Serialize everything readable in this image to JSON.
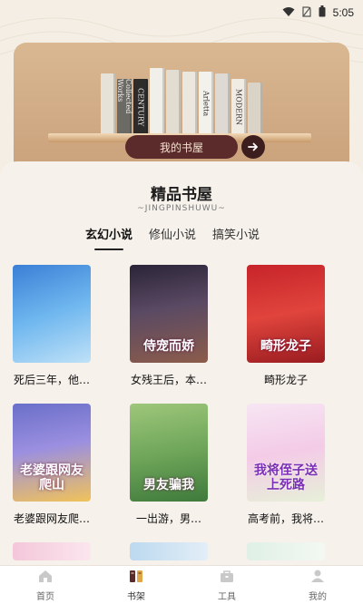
{
  "status": {
    "time": "5:05"
  },
  "hero": {
    "books": [
      {
        "spine": "",
        "color": "#e7e2d8",
        "h": 68
      },
      {
        "spine": "Collected Works",
        "color": "#6c6a64",
        "h": 62
      },
      {
        "spine": "CENTURY",
        "color": "#2e2c2a",
        "h": 62
      },
      {
        "spine": "",
        "color": "#f1efe9",
        "h": 74
      },
      {
        "spine": "",
        "color": "#e3ddd1",
        "h": 72
      },
      {
        "spine": "",
        "color": "#ebe7df",
        "h": 70
      },
      {
        "spine": "Arletta",
        "color": "#f3f1ec",
        "h": 70
      },
      {
        "spine": "",
        "color": "#dedad3",
        "h": 68
      },
      {
        "spine": "MODERN",
        "color": "#f0ece4",
        "h": 62
      },
      {
        "spine": "",
        "color": "#d9d3c8",
        "h": 58
      }
    ],
    "shelf_button": "我的书屋"
  },
  "panel": {
    "title": "精品书屋",
    "subtitle": "~JINGPINSHUWU~",
    "tabs": [
      {
        "label": "玄幻小说",
        "active": true
      },
      {
        "label": "修仙小说",
        "active": false
      },
      {
        "label": "搞笑小说",
        "active": false
      }
    ],
    "books": [
      {
        "name": "死后三年，他…",
        "cover_text": "",
        "bg": "linear-gradient(160deg,#3a7fd6 0%,#6fb7ef 50%,#bfe1f7 100%)"
      },
      {
        "name": "女残王后，本…",
        "cover_text": "侍宠而娇",
        "bg": "linear-gradient(170deg,#2a2438 0%,#5b4a63 45%,#8c5c4b 100%)"
      },
      {
        "name": "畸形龙子",
        "cover_text": "畸形龙子",
        "bg": "linear-gradient(170deg,#c7242a 0%,#e0443c 50%,#9a1c20 100%)"
      },
      {
        "name": "老婆跟网友爬…",
        "cover_text": "老婆跟网友爬山",
        "bg": "linear-gradient(170deg,#6a6fc9 0%,#9b8fe0 45%,#f0c25a 100%)"
      },
      {
        "name": "一出游，男…",
        "cover_text": "男友骗我",
        "bg": "linear-gradient(170deg,#9ec77a 0%,#6fa65a 50%,#3f7a3c 100%)"
      },
      {
        "name": "高考前，我将…",
        "cover_text": "我将侄子送上死路",
        "bg": "linear-gradient(170deg,#f6e6f3 0%,#f4cbe7 50%,#e6f0d8 100%)"
      }
    ]
  },
  "nav": [
    {
      "label": "首页",
      "icon": "home-icon",
      "active": false
    },
    {
      "label": "书架",
      "icon": "bookshelf-icon",
      "active": true
    },
    {
      "label": "工具",
      "icon": "toolbox-icon",
      "active": false
    },
    {
      "label": "我的",
      "icon": "user-icon",
      "active": false
    }
  ]
}
